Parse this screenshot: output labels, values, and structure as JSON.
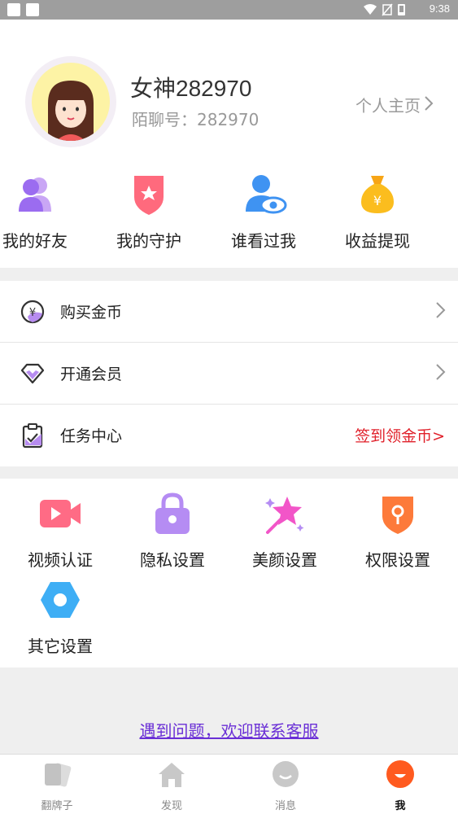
{
  "status_bar": {
    "time": "9:38"
  },
  "profile": {
    "nickname": "女神282970",
    "id_text": "陌聊号：282970",
    "homepage_label": "个人主页"
  },
  "quick_actions": [
    {
      "label": "我的好友",
      "icon": "friends-icon"
    },
    {
      "label": "我的守护",
      "icon": "guard-shield-icon"
    },
    {
      "label": "谁看过我",
      "icon": "visitor-eye-icon"
    },
    {
      "label": "收益提现",
      "icon": "money-bag-icon"
    }
  ],
  "menu": {
    "buy_coins": "购买金币",
    "vip": "开通会员",
    "tasks": "任务中心",
    "tasks_extra": "签到领金币>"
  },
  "settings": [
    {
      "label": "视频认证",
      "icon": "video-camera-icon"
    },
    {
      "label": "隐私设置",
      "icon": "lock-icon"
    },
    {
      "label": "美颜设置",
      "icon": "magic-star-icon"
    },
    {
      "label": "权限设置",
      "icon": "permission-shield-icon"
    },
    {
      "label": "其它设置",
      "icon": "settings-hexagon-icon"
    }
  ],
  "contact_text": "遇到问题，欢迎联系客服",
  "bottom_nav": [
    {
      "label": "翻牌子",
      "icon": "cards-icon",
      "active": false
    },
    {
      "label": "发现",
      "icon": "home-icon",
      "active": false
    },
    {
      "label": "消息",
      "icon": "message-icon",
      "active": false
    },
    {
      "label": "我",
      "icon": "me-icon",
      "active": true
    }
  ],
  "colors": {
    "accent_red": "#e0202a",
    "link_purple": "#6a2fd6",
    "active_orange": "#ff5a1f",
    "divider": "#efefef"
  }
}
